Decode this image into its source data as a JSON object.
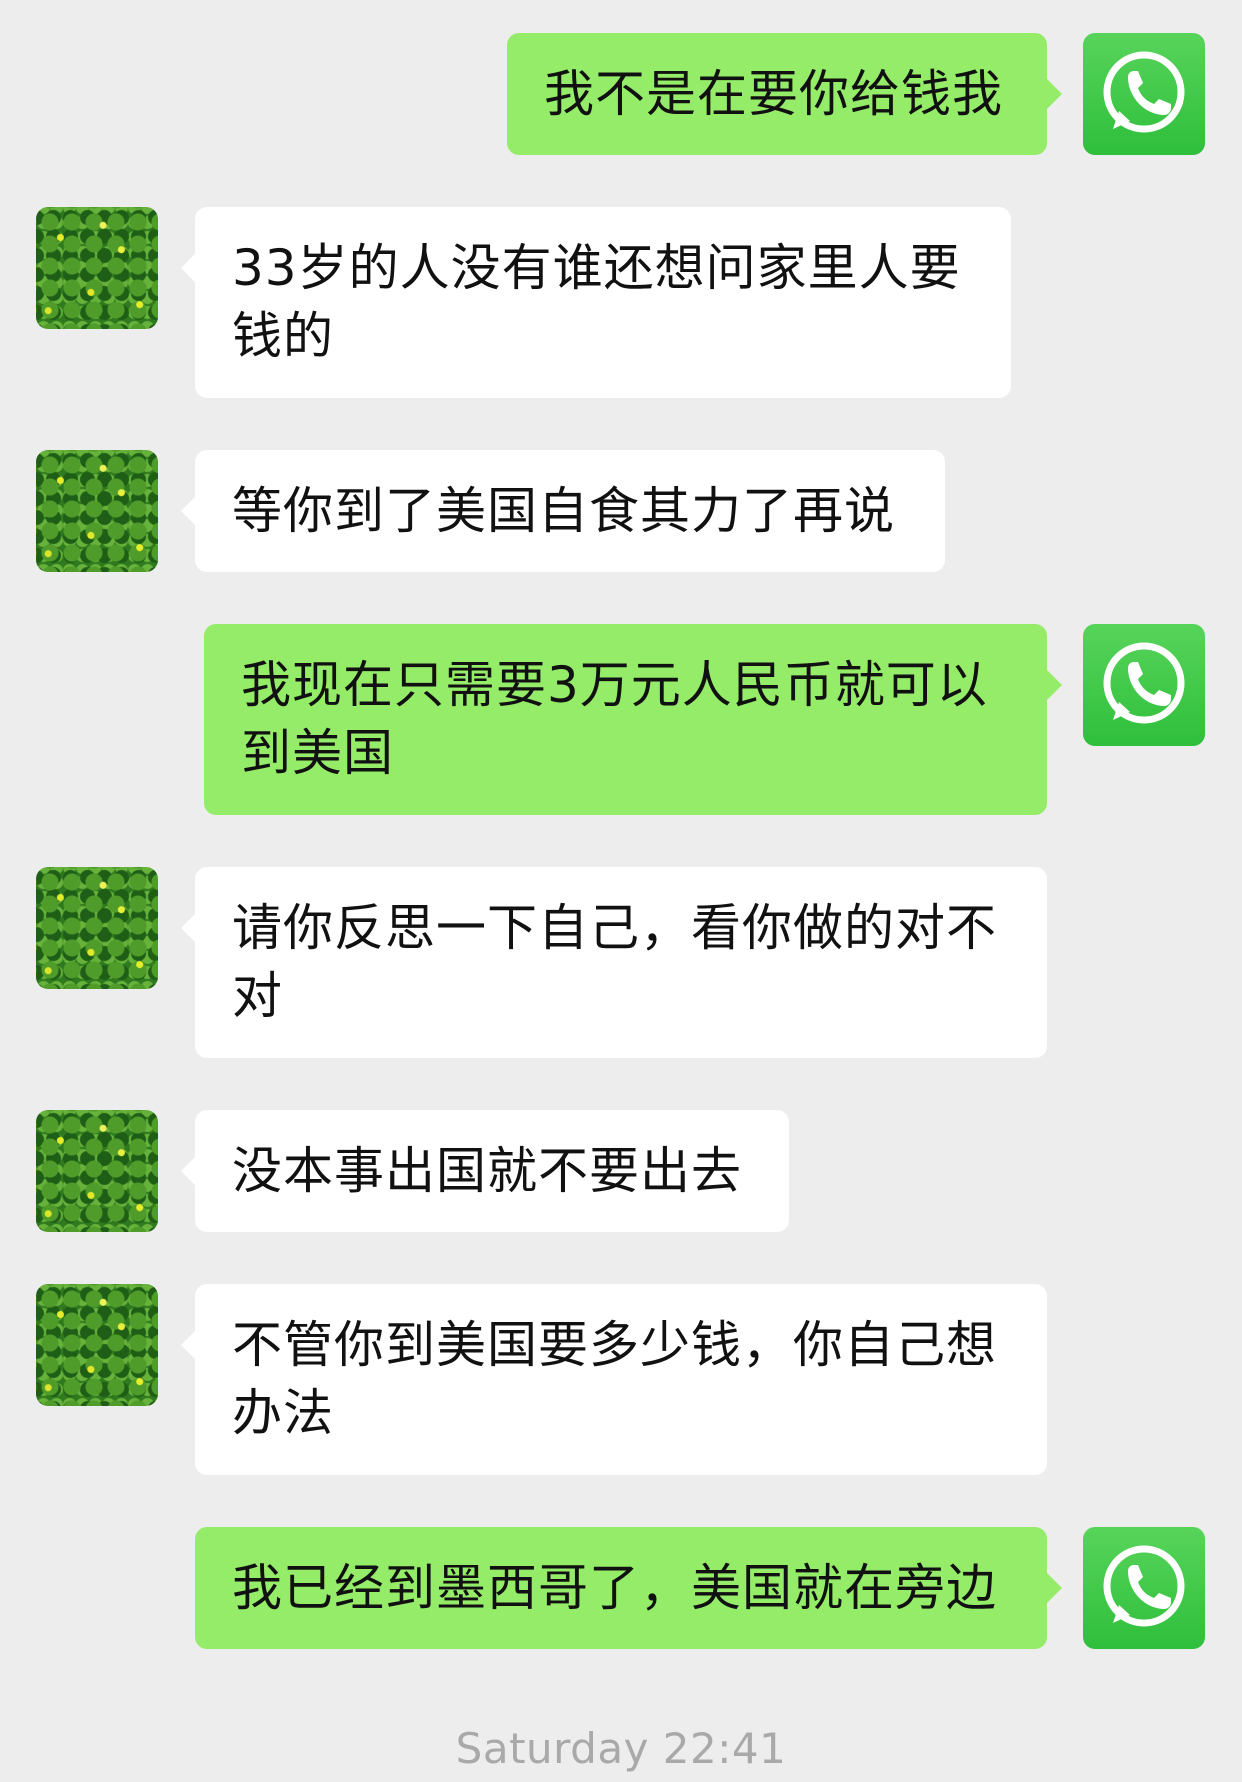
{
  "messages": [
    {
      "side": "out",
      "text": "我不是在要你给钱我",
      "icon": "whatsapp-icon"
    },
    {
      "side": "in",
      "text": "33岁的人没有谁还想问家里人要\n钱的",
      "icon": "clover-avatar"
    },
    {
      "side": "in",
      "text": "等你到了美国自食其力了再说",
      "icon": "clover-avatar"
    },
    {
      "side": "out",
      "text": "我现在只需要3万元人民币就可以\n到美国",
      "icon": "whatsapp-icon"
    },
    {
      "side": "in",
      "text": "请你反思一下自己，看你做的对不\n对",
      "icon": "clover-avatar"
    },
    {
      "side": "in",
      "text": "没本事出国就不要出去",
      "icon": "clover-avatar"
    },
    {
      "side": "in",
      "text": "不管你到美国要多少钱，你自己想\n办法",
      "icon": "clover-avatar"
    },
    {
      "side": "out",
      "text": "我已经到墨西哥了，美国就在旁边",
      "icon": "whatsapp-icon"
    }
  ],
  "timestamp": "Saturday 22:41",
  "colors": {
    "background": "#ededed",
    "outgoing_bubble": "#95ec69",
    "incoming_bubble": "#ffffff",
    "whatsapp_green": "#3ecb3e",
    "timestamp_text": "#a9a9a9"
  }
}
